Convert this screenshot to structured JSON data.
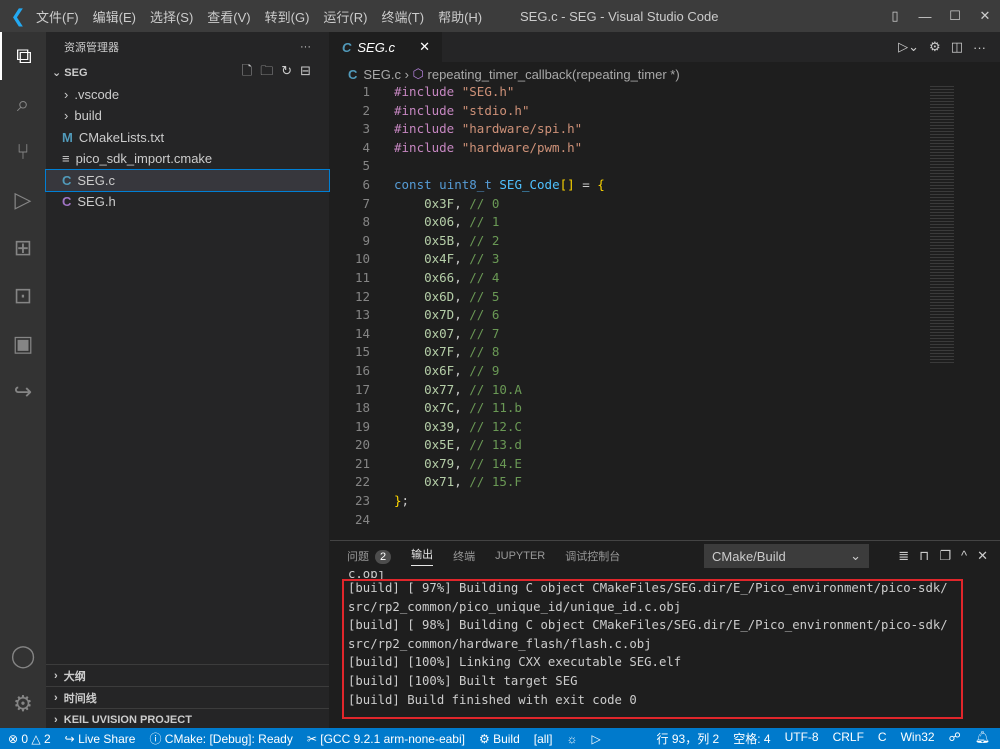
{
  "title": {
    "app": "SEG.c - SEG - Visual Studio Code",
    "menu": [
      "文件(F)",
      "编辑(E)",
      "选择(S)",
      "查看(V)",
      "转到(G)",
      "运行(R)",
      "终端(T)",
      "帮助(H)"
    ]
  },
  "sidebar": {
    "title": "资源管理器",
    "root": "SEG",
    "items": [
      {
        "label": ".vscode",
        "type": "folder"
      },
      {
        "label": "build",
        "type": "folder"
      },
      {
        "label": "CMakeLists.txt",
        "type": "cmake"
      },
      {
        "label": "pico_sdk_import.cmake",
        "type": "text"
      },
      {
        "label": "SEG.c",
        "type": "c",
        "selected": true
      },
      {
        "label": "SEG.h",
        "type": "h"
      }
    ],
    "sections": [
      "大纲",
      "时间线",
      "KEIL UVISION PROJECT"
    ]
  },
  "editor": {
    "tab": "SEG.c",
    "breadcrumb": [
      "SEG.c",
      "repeating_timer_callback(repeating_timer *)"
    ],
    "lines": [
      {
        "n": "1",
        "html": "<span class='kw'>#include</span> <span class='st'>\"SEG.h\"</span>"
      },
      {
        "n": "2",
        "html": "<span class='kw'>#include</span> <span class='st'>\"stdio.h\"</span>"
      },
      {
        "n": "3",
        "html": "<span class='kw'>#include</span> <span class='st'>\"hardware/spi.h\"</span>"
      },
      {
        "n": "4",
        "html": "<span class='kw'>#include</span> <span class='st'>\"hardware/pwm.h\"</span>"
      },
      {
        "n": "5",
        "html": ""
      },
      {
        "n": "6",
        "html": "<span class='ty'>const</span> <span class='ty'>uint8_t</span> <span class='id'>SEG_Code</span><span class='br'>[]</span> = <span class='br'>{</span>"
      },
      {
        "n": "7",
        "html": "    <span class='nm'>0x3F</span>, <span class='cm'>// 0</span>"
      },
      {
        "n": "8",
        "html": "    <span class='nm'>0x06</span>, <span class='cm'>// 1</span>"
      },
      {
        "n": "9",
        "html": "    <span class='nm'>0x5B</span>, <span class='cm'>// 2</span>"
      },
      {
        "n": "10",
        "html": "    <span class='nm'>0x4F</span>, <span class='cm'>// 3</span>"
      },
      {
        "n": "11",
        "html": "    <span class='nm'>0x66</span>, <span class='cm'>// 4</span>"
      },
      {
        "n": "12",
        "html": "    <span class='nm'>0x6D</span>, <span class='cm'>// 5</span>"
      },
      {
        "n": "13",
        "html": "    <span class='nm'>0x7D</span>, <span class='cm'>// 6</span>"
      },
      {
        "n": "14",
        "html": "    <span class='nm'>0x07</span>, <span class='cm'>// 7</span>"
      },
      {
        "n": "15",
        "html": "    <span class='nm'>0x7F</span>, <span class='cm'>// 8</span>"
      },
      {
        "n": "16",
        "html": "    <span class='nm'>0x6F</span>, <span class='cm'>// 9</span>"
      },
      {
        "n": "17",
        "html": "    <span class='nm'>0x77</span>, <span class='cm'>// 10.A</span>"
      },
      {
        "n": "18",
        "html": "    <span class='nm'>0x7C</span>, <span class='cm'>// 11.b</span>"
      },
      {
        "n": "19",
        "html": "    <span class='nm'>0x39</span>, <span class='cm'>// 12.C</span>"
      },
      {
        "n": "20",
        "html": "    <span class='nm'>0x5E</span>, <span class='cm'>// 13.d</span>"
      },
      {
        "n": "21",
        "html": "    <span class='nm'>0x79</span>, <span class='cm'>// 14.E</span>"
      },
      {
        "n": "22",
        "html": "    <span class='nm'>0x71</span>, <span class='cm'>// 15.F</span>"
      },
      {
        "n": "23",
        "html": "<span class='br'>}</span>;"
      },
      {
        "n": "24",
        "html": ""
      }
    ]
  },
  "panel": {
    "tabs": [
      "问题",
      "输出",
      "终端",
      "JUPYTER",
      "调试控制台"
    ],
    "problems_count": "2",
    "active_tab": "输出",
    "channel": "CMake/Build",
    "output": [
      "c.obj",
      "[build] [ 97%] Building C object CMakeFiles/SEG.dir/E_/Pico_environment/pico-sdk/",
      "src/rp2_common/pico_unique_id/unique_id.c.obj",
      "[build] [ 98%] Building C object CMakeFiles/SEG.dir/E_/Pico_environment/pico-sdk/",
      "src/rp2_common/hardware_flash/flash.c.obj",
      "[build] [100%] Linking CXX executable SEG.elf",
      "[build] [100%] Built target SEG",
      "[build] Build finished with exit code 0"
    ],
    "highlight_color": "#e0262b"
  },
  "status": {
    "errors": "0",
    "warnings": "2",
    "live_share": "Live Share",
    "cmake": "CMake: [Debug]: Ready",
    "kit": "[GCC 9.2.1 arm-none-eabi]",
    "build": "Build",
    "target": "[all]",
    "position": "行 93，列 2",
    "spaces": "空格: 4",
    "encoding": "UTF-8",
    "eol": "CRLF",
    "language": "C",
    "platform": "Win32"
  }
}
